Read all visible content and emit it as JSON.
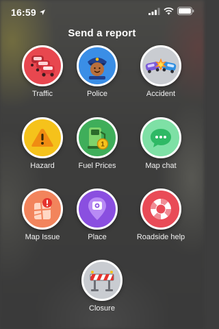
{
  "status_bar": {
    "time": "16:59"
  },
  "title": "Send a report",
  "reports": [
    {
      "label": "Traffic",
      "icon": "traffic-cars-icon",
      "color": "#e8474f"
    },
    {
      "label": "Police",
      "icon": "police-officer-icon",
      "color": "#3a8ee6"
    },
    {
      "label": "Accident",
      "icon": "car-crash-icon",
      "color": "#c9ccd1"
    },
    {
      "label": "Hazard",
      "icon": "warning-triangle-icon",
      "color": "#f5c21b"
    },
    {
      "label": "Fuel Prices",
      "icon": "fuel-pump-icon",
      "color": "#3fae5a"
    },
    {
      "label": "Map chat",
      "icon": "chat-bubble-icon",
      "color": "#7ee0a5"
    },
    {
      "label": "Map Issue",
      "icon": "map-issue-icon",
      "color": "#f2845c"
    },
    {
      "label": "Place",
      "icon": "place-pin-icon",
      "color": "#8a4fe0"
    },
    {
      "label": "Roadside help",
      "icon": "lifebuoy-icon",
      "color": "#e94b57"
    }
  ],
  "closure": {
    "label": "Closure",
    "icon": "road-barrier-icon",
    "color": "#c9ccd1"
  }
}
